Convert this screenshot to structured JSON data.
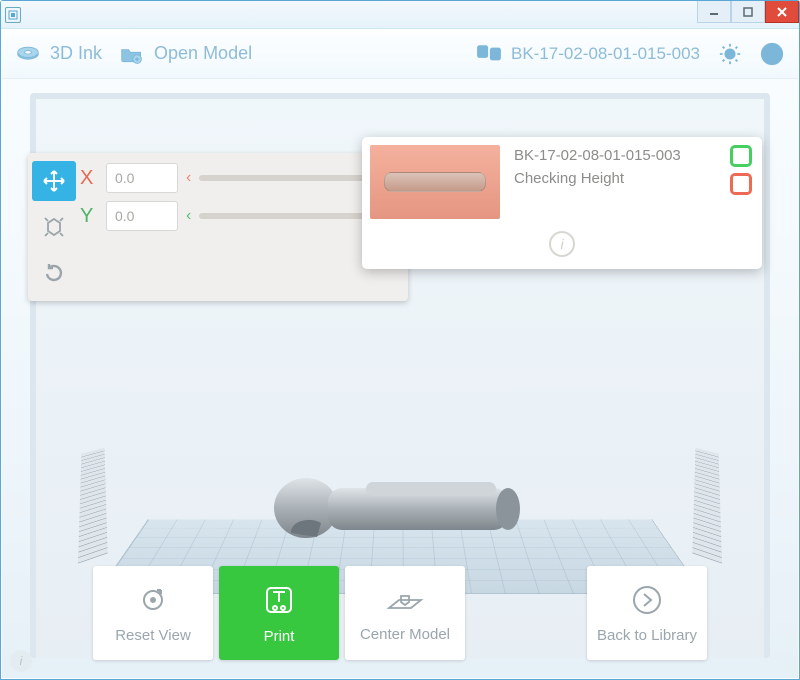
{
  "window": {
    "title": ""
  },
  "toolbar": {
    "ink_label": "3D Ink",
    "open_model_label": "Open Model",
    "model_name": "BK-17-02-08-01-015-003"
  },
  "transform": {
    "x_label": "X",
    "y_label": "Y",
    "x_value": "0.0",
    "y_value": "0.0"
  },
  "popup": {
    "title": "BK-17-02-08-01-015-003",
    "status": "Checking Height"
  },
  "buttons": {
    "reset_view": "Reset View",
    "print": "Print",
    "center_model": "Center Model",
    "back_to_library": "Back to Library"
  }
}
